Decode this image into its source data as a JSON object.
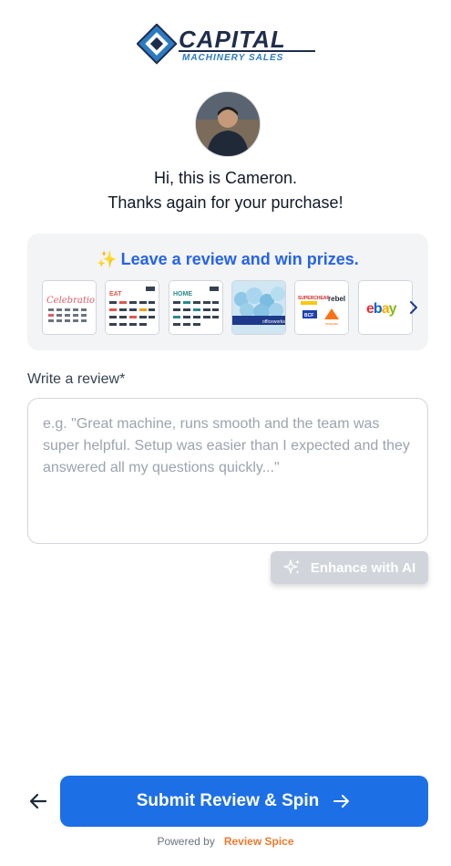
{
  "brand": {
    "name_line1": "CAPITAL",
    "name_line2": "MACHINERY SALES",
    "accent": "#2b7bc4",
    "dark": "#1f2d4d"
  },
  "greeting": {
    "line1": "Hi, this is Cameron.",
    "line2": "Thanks again for your purchase!"
  },
  "prizes": {
    "spark_icon": "✨",
    "title": "Leave a review and win prizes.",
    "cards": [
      {
        "name": "celebration-gift-card",
        "label": "Celebration"
      },
      {
        "name": "eat-gift-card",
        "label": "EAT"
      },
      {
        "name": "home-gift-card",
        "label": "HOME"
      },
      {
        "name": "officeworks-gift-card",
        "label": "officeworks"
      },
      {
        "name": "supercheap-rebel-gift-card",
        "label": "SUPERCHEAP"
      },
      {
        "name": "ebay-gift-card",
        "label": "ebay"
      }
    ]
  },
  "review": {
    "label": "Write a review*",
    "value": "",
    "placeholder": "e.g. \"Great machine, runs smooth and the team was super helpful. Setup was easier than I expected and they answered all my questions quickly...\""
  },
  "enhance": {
    "label": "Enhance with AI"
  },
  "submit": {
    "label": "Submit Review & Spin"
  },
  "footer": {
    "powered_by": "Powered by",
    "provider": "Review Spice"
  },
  "colors": {
    "primary": "#1d6fe6",
    "prize_title": "#2563eb",
    "provider": "#ea7a2e",
    "enhance_bg": "#d1d5db"
  }
}
